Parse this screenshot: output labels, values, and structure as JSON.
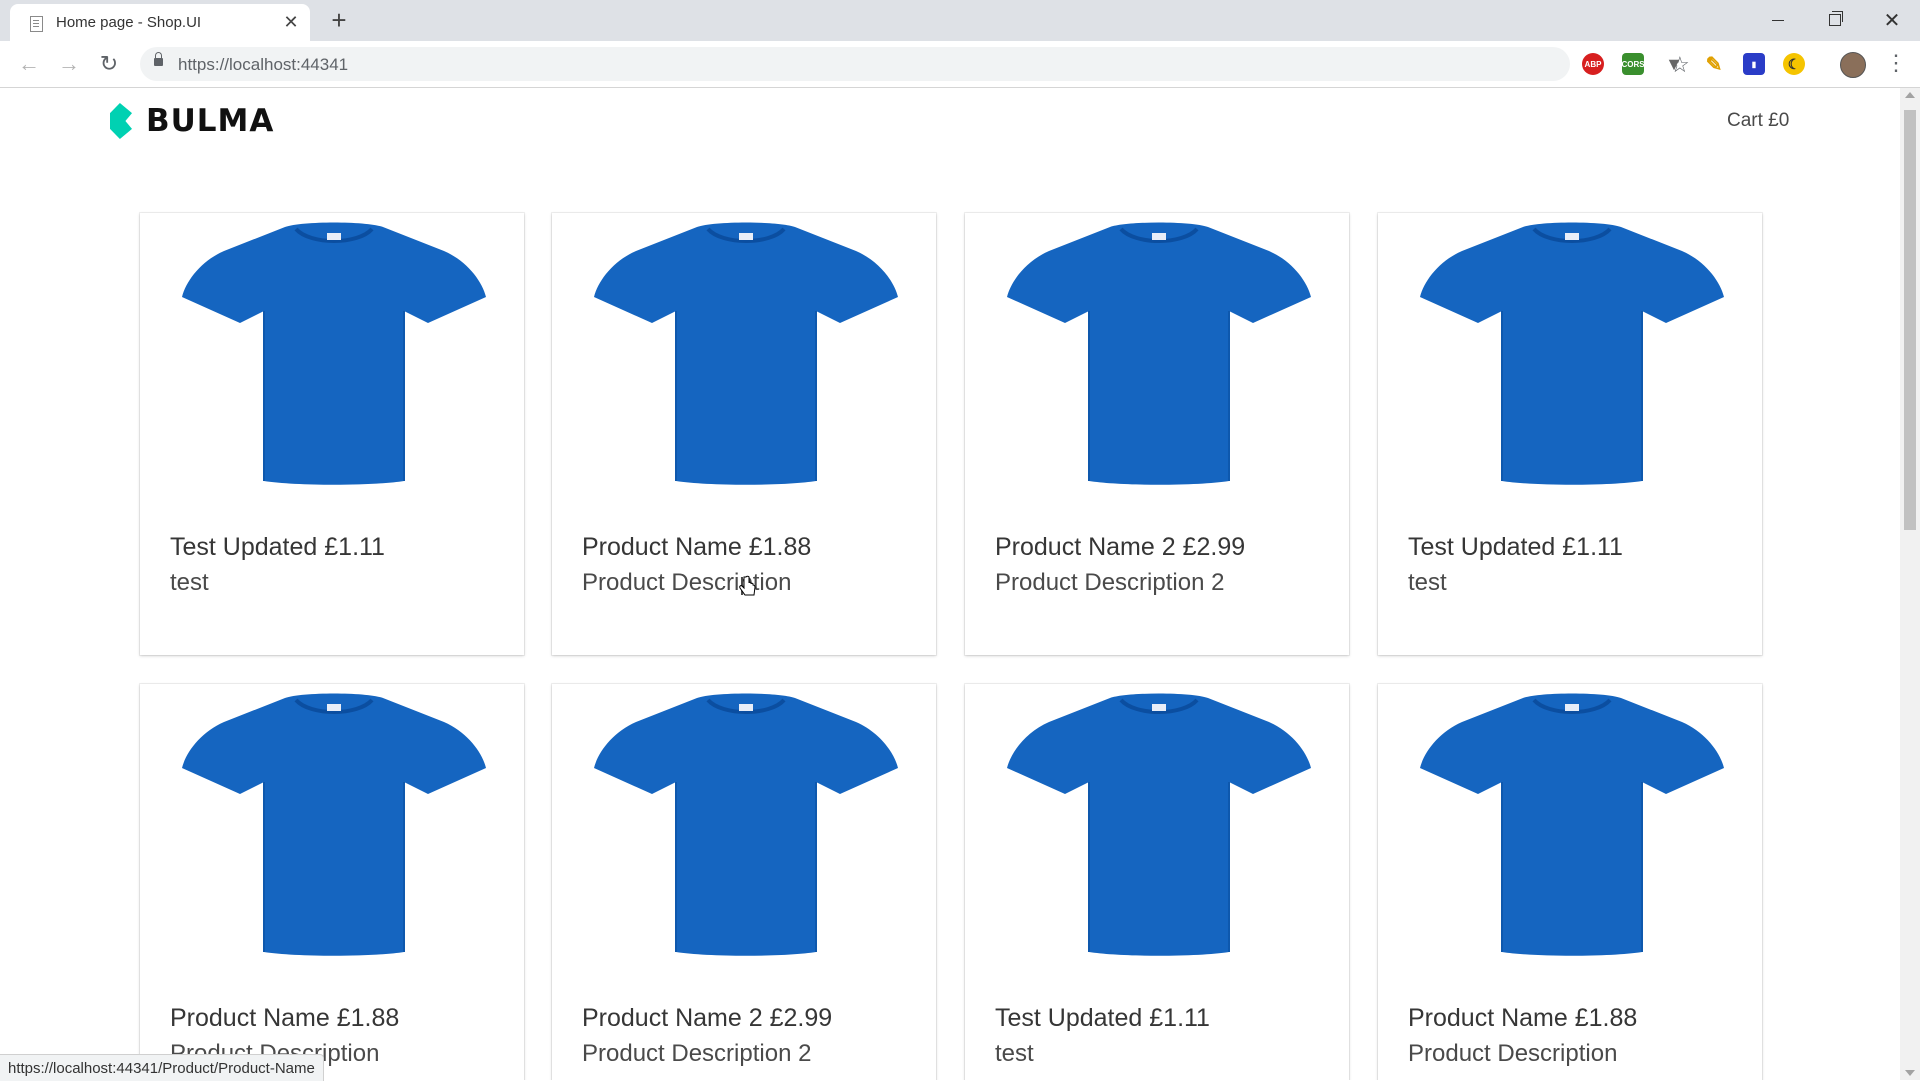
{
  "browser": {
    "tab_title": "Home page - Shop.UI",
    "url": "https://localhost:44341",
    "status_url": "https://localhost:44341/Product/Product-Name",
    "extensions": [
      "ABP",
      "CORS",
      "V",
      "pen",
      "block",
      "moon"
    ]
  },
  "site": {
    "logo_text": "BULMA",
    "cart_label": "Cart £0",
    "brand_color": "#00d1b2",
    "product_color": "#1565c0"
  },
  "products": [
    {
      "title": "Test Updated £1.11",
      "description": "test"
    },
    {
      "title": "Product Name £1.88",
      "description": "Product Description"
    },
    {
      "title": "Product Name 2 £2.99",
      "description": "Product Description 2"
    },
    {
      "title": "Test Updated £1.11",
      "description": "test"
    },
    {
      "title": "Product Name £1.88",
      "description": "Product Description"
    },
    {
      "title": "Product Name 2 £2.99",
      "description": "Product Description 2"
    },
    {
      "title": "Test Updated £1.11",
      "description": "test"
    },
    {
      "title": "Product Name £1.88",
      "description": "Product Description"
    }
  ]
}
